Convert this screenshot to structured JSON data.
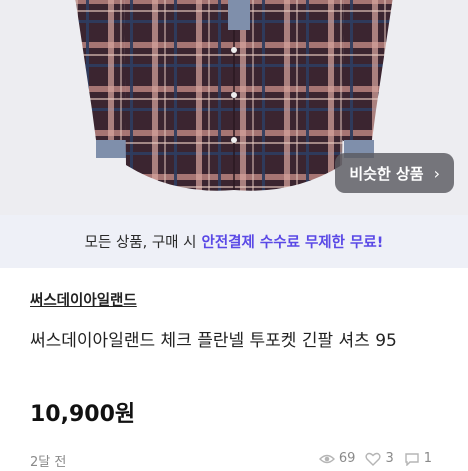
{
  "hero": {
    "similar_button_label": "비슷한 상품",
    "similar_button_chevron": "›",
    "colors": {
      "plaid_base": "#3b2530",
      "plaid_light": "#d9a7a0",
      "plaid_blue": "#2e3c60",
      "denim": "#7f8fab"
    }
  },
  "banner": {
    "prefix": "모든 상품, 구매 시",
    "highlight": "안전결제 수수료 무제한 무료!",
    "accent": "#5a49e6"
  },
  "product": {
    "shop_name": "써스데이아일랜드",
    "title": "써스데이아일랜드 체크 플란넬 투포켓 긴팔 셔츠 95",
    "price": "10,900원"
  },
  "meta": {
    "time_ago": "2달 전",
    "views": "69",
    "likes": "3",
    "chats": "1",
    "icons": [
      "eye-icon",
      "heart-icon",
      "chat-icon"
    ]
  }
}
